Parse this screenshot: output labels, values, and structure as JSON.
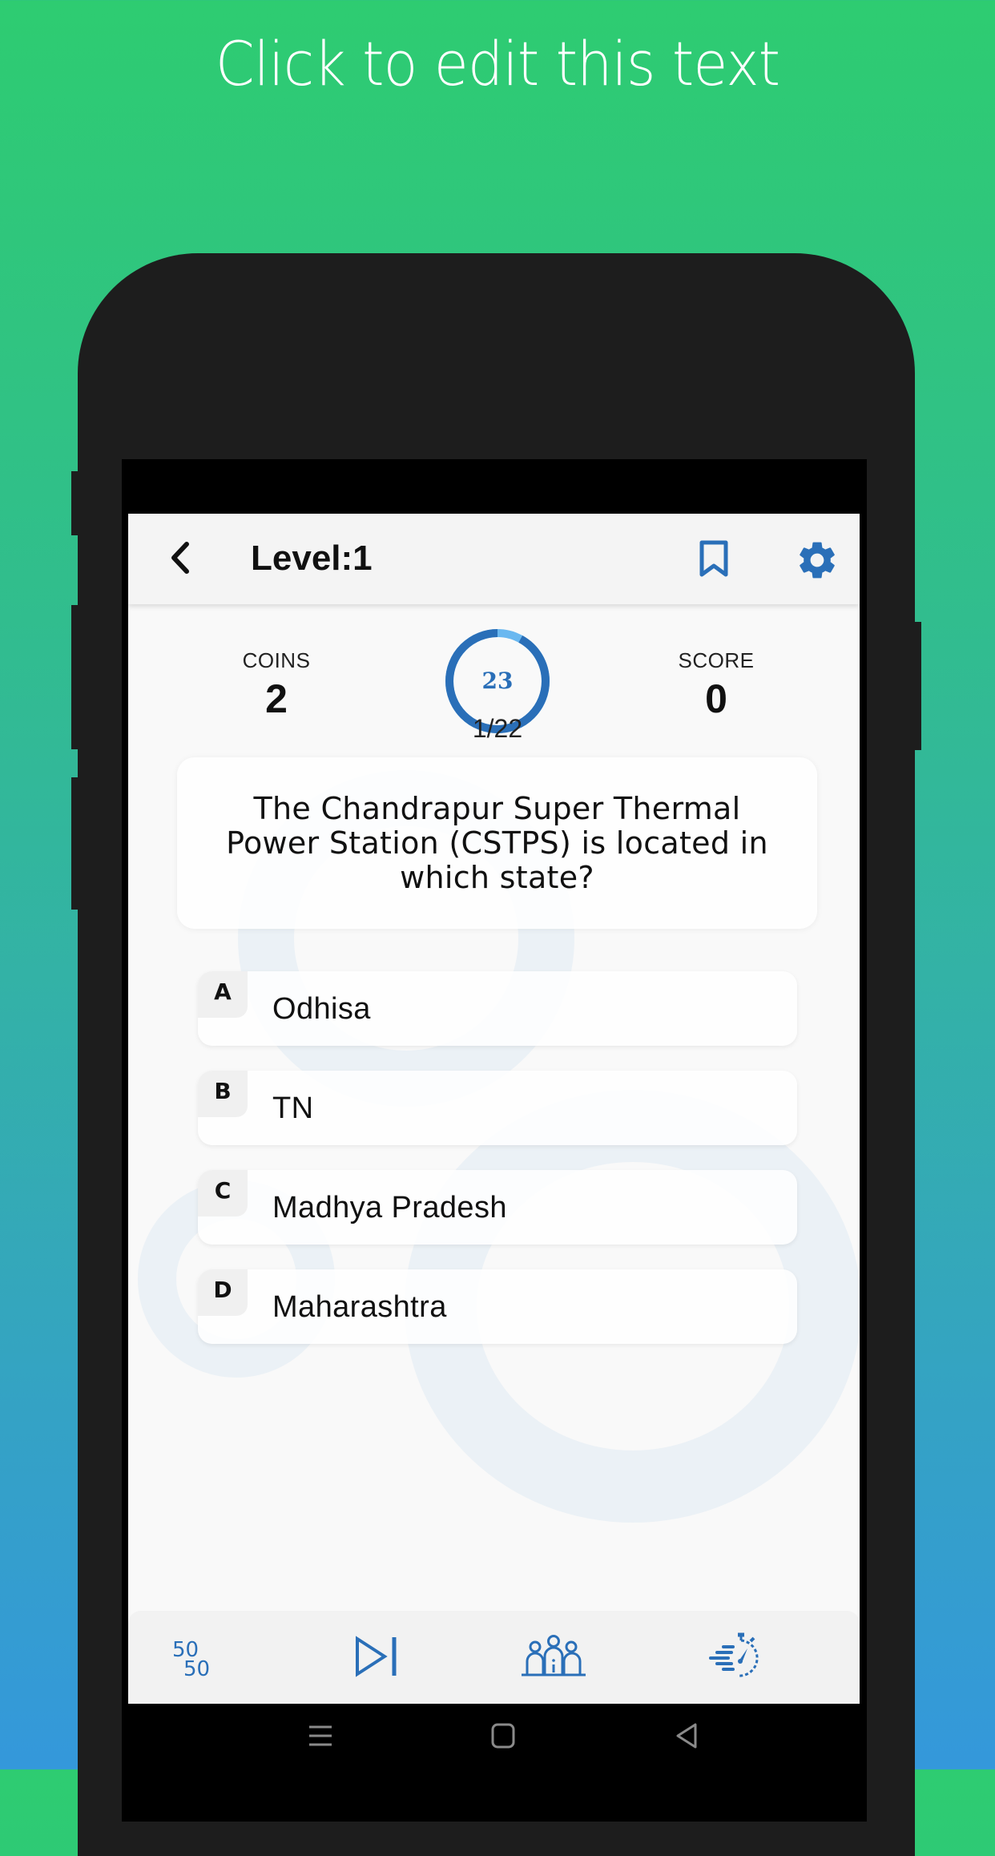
{
  "promo": {
    "headline": "Click to edit this text"
  },
  "colors": {
    "accent": "#2a6fb8",
    "timer_remaining": "#6ab8f0",
    "gradient_top": "#2ecc71",
    "gradient_bottom": "#3498db"
  },
  "appbar": {
    "back_icon": "chevron-left-icon",
    "title": "Level:1",
    "bookmark_icon": "bookmark-icon",
    "settings_icon": "gear-icon"
  },
  "stats": {
    "coins_label": "COINS",
    "coins_value": "2",
    "score_label": "SCORE",
    "score_value": "0",
    "timer_seconds": "23",
    "timer_progress": 0.92,
    "question_progress": "1/22"
  },
  "question": {
    "text": "The Chandrapur Super Thermal Power Station (CSTPS) is located in which state?"
  },
  "options": [
    {
      "letter": "A",
      "text": "Odhisa"
    },
    {
      "letter": "B",
      "text": "TN"
    },
    {
      "letter": "C",
      "text": "Madhya Pradesh"
    },
    {
      "letter": "D",
      "text": "Maharashtra"
    }
  ],
  "lifelines": [
    {
      "name": "fifty-fifty",
      "icon": "fifty-fifty-icon",
      "label": "50/50"
    },
    {
      "name": "skip",
      "icon": "skip-next-icon"
    },
    {
      "name": "audience-poll",
      "icon": "audience-poll-icon"
    },
    {
      "name": "time-extension",
      "icon": "stopwatch-icon"
    }
  ],
  "system_nav": {
    "recents_icon": "recents-icon",
    "home_icon": "home-icon",
    "back_icon": "back-triangle-icon"
  }
}
